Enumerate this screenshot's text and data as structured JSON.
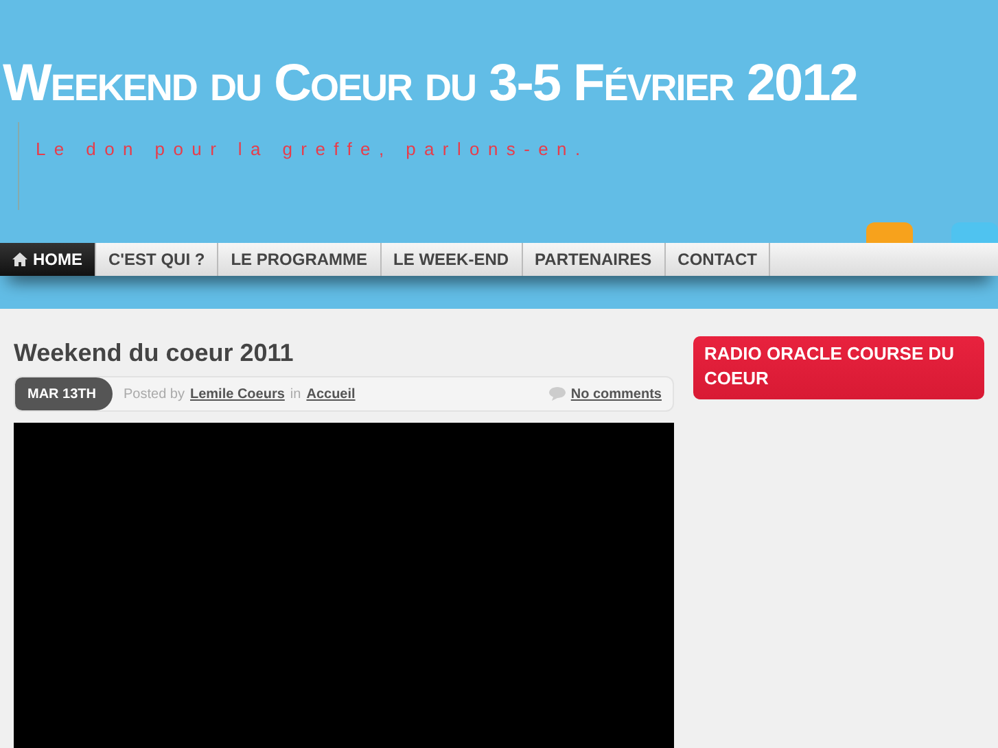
{
  "header": {
    "title": "Weekend du Coeur du 3-5 Février 2012",
    "tagline": "Le don pour la greffe, parlons-en."
  },
  "nav": [
    {
      "label": "HOME",
      "selected": true,
      "kind": "home"
    },
    {
      "label": "C'EST QUI ?",
      "selected": false,
      "kind": "page"
    },
    {
      "label": "LE PROGRAMME",
      "selected": false,
      "kind": "page"
    },
    {
      "label": "LE WEEK-END",
      "selected": false,
      "kind": "page"
    },
    {
      "label": "PARTENAIRES",
      "selected": false,
      "kind": "page"
    },
    {
      "label": "CONTACT",
      "selected": false,
      "kind": "page"
    }
  ],
  "post": {
    "title": "Weekend du coeur 2011",
    "date": "MAR 13TH",
    "posted_by": "Posted by",
    "author": "Lemile Coeurs",
    "in": "in",
    "category": "Accueil",
    "comments": "No comments"
  },
  "sidebar": {
    "widget_title": "RADIO ORACLE COURSE DU COEUR"
  }
}
